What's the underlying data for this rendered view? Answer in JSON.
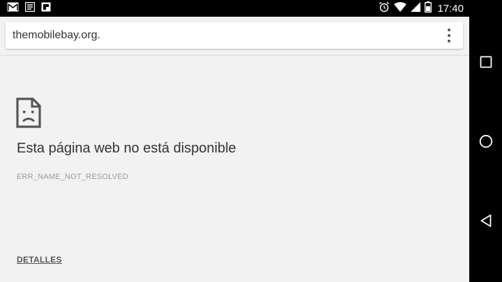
{
  "status_bar": {
    "time": "17:40",
    "left_icons": [
      "gmail-icon",
      "notes-icon",
      "flipboard-icon"
    ],
    "right_icons": [
      "alarm-icon",
      "wifi-icon",
      "signal-icon",
      "battery-icon"
    ]
  },
  "browser": {
    "url": "themobilebay.org.",
    "menu_icon": "overflow-menu-icon"
  },
  "error_page": {
    "icon": "sad-page-icon",
    "title": "Esta página web no está disponible",
    "code": "ERR_NAME_NOT_RESOLVED",
    "details_label": "DETALLES"
  },
  "nav_bar": {
    "buttons": [
      "recents-square-icon",
      "home-circle-icon",
      "back-triangle-icon"
    ]
  },
  "colors": {
    "page_background": "#f2f2f2",
    "toolbar_background": "#f2f2f2",
    "system_bar": "#000000",
    "title_text": "#333333",
    "code_text": "#9a9a9a"
  }
}
